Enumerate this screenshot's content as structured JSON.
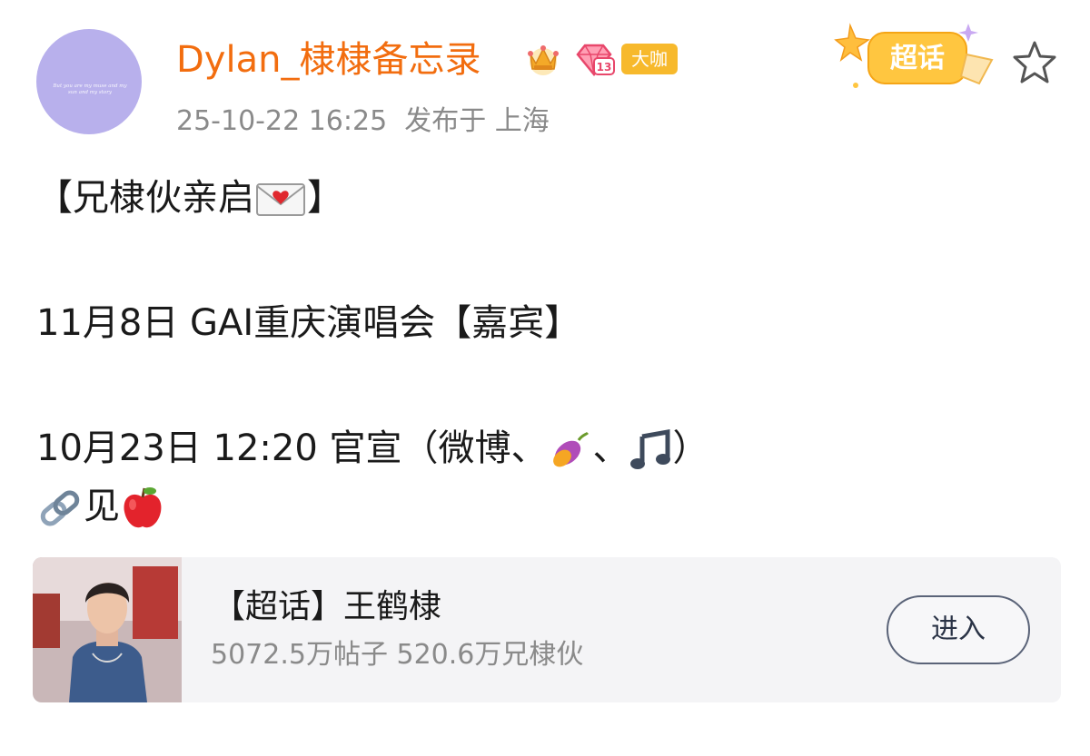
{
  "header": {
    "username": "Dylan_棣棣备忘录",
    "timestamp": "25-10-22 16:25",
    "location": "发布于 上海",
    "badge_level": "13",
    "badge_daka": "大咖",
    "supertopic_badge": "超话",
    "avatar_text": "But you are my muse and my sun and my story"
  },
  "post": {
    "line1": "【兄棣伙亲启",
    "line1_end": "】",
    "line2": "11月8日 GAI重庆演唱会【嘉宾】",
    "line3_a": "10月23日 12:20 官宣（微博、",
    "line3_b": "、",
    "line3_c": "）",
    "line4": "见"
  },
  "card": {
    "title": "【超话】王鹤棣",
    "stats": "5072.5万帖子 520.6万兄棣伙",
    "button": "进入"
  },
  "icons": {
    "crown": "crown-icon",
    "diamond": "diamond-level-icon",
    "supertopic": "supertopic-badge-icon",
    "star": "star-outline-icon",
    "envelope": "love-letter-envelope-icon",
    "sweet_potato": "sweet-potato-icon",
    "music": "music-note-icon",
    "link": "link-icon",
    "apple": "red-apple-icon"
  },
  "colors": {
    "username": "#f26d0f",
    "meta": "#8a8a8a",
    "card_bg": "#f4f4f6",
    "daka_badge": "#f7b92c"
  }
}
